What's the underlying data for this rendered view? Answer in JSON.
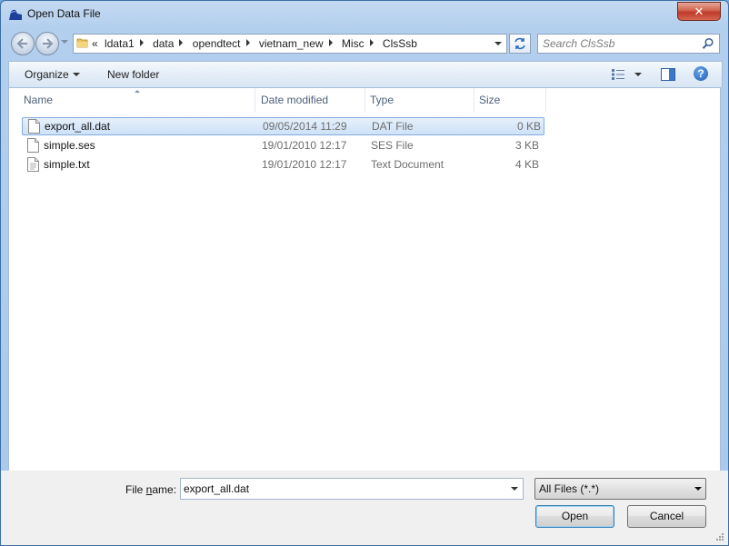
{
  "window": {
    "title": "Open Data File",
    "close_label": "✕"
  },
  "address": {
    "overflow": "«",
    "crumbs": [
      "ldata1",
      "data",
      "opendtect",
      "vietnam_new",
      "Misc",
      "ClsSsb"
    ]
  },
  "search": {
    "placeholder": "Search ClsSsb"
  },
  "toolbar": {
    "organize": "Organize",
    "new_folder": "New folder",
    "help": "?"
  },
  "columns": {
    "name": "Name",
    "date": "Date modified",
    "type": "Type",
    "size": "Size"
  },
  "files": [
    {
      "name": "export_all.dat",
      "date": "09/05/2014 11:29",
      "type": "DAT File",
      "size": "0 KB",
      "selected": true
    },
    {
      "name": "simple.ses",
      "date": "19/01/2010 12:17",
      "type": "SES File",
      "size": "3 KB",
      "selected": false
    },
    {
      "name": "simple.txt",
      "date": "19/01/2010 12:17",
      "type": "Text Document",
      "size": "4 KB",
      "selected": false
    }
  ],
  "bottom": {
    "filename_label_pre": "File ",
    "filename_label_u": "n",
    "filename_label_post": "ame:",
    "filename_value": "export_all.dat",
    "filter_value": "All Files (*.*)",
    "open_label": "Open",
    "cancel_label": "Cancel"
  },
  "colors": {
    "accent": "#3b6ea5",
    "selection": "#cde1f7",
    "header_text": "#4c607a"
  }
}
